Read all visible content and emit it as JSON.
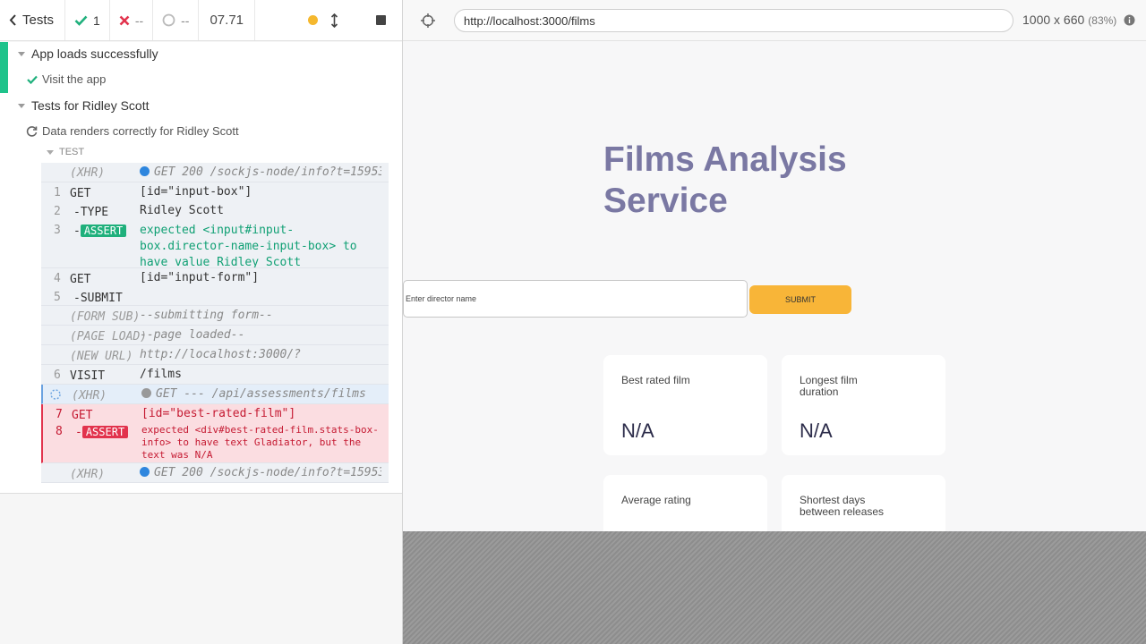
{
  "reporter": {
    "header": {
      "tests_label": "Tests",
      "passed": "1",
      "failed": "--",
      "pending": "--",
      "duration": "07.71"
    },
    "suites": [
      {
        "title": "App loads successfully",
        "tests": [
          {
            "title": "Visit the app",
            "state": "passed"
          }
        ]
      },
      {
        "title": "Tests for Ridley Scott",
        "tests": [
          {
            "title": "Data renders correctly for Ridley Scott",
            "state": "running"
          }
        ]
      }
    ],
    "test_section_label": "TEST",
    "commands": [
      {
        "num": "",
        "name": "(XHR)",
        "msg": "GET 200 /sockjs-node/info?t=159535…"
      },
      {
        "num": "1",
        "name": "GET",
        "msg": "[id=\"input-box\"]"
      },
      {
        "num": "2",
        "name": "-TYPE",
        "msg": "Ridley Scott"
      },
      {
        "num": "3",
        "name": "-",
        "badge": "ASSERT",
        "msg_parts": [
          "expected",
          "<input#input-box.director-name-input-box>",
          "to have value",
          "Ridley Scott"
        ]
      },
      {
        "num": "4",
        "name": "GET",
        "msg": "[id=\"input-form\"]"
      },
      {
        "num": "5",
        "name": "-SUBMIT",
        "msg": ""
      },
      {
        "num": "",
        "name": "(FORM SUB)",
        "msg": "--submitting form--"
      },
      {
        "num": "",
        "name": "(PAGE LOAD)",
        "msg": "--page loaded--"
      },
      {
        "num": "",
        "name": "(NEW URL)",
        "msg": "http://localhost:3000/?"
      },
      {
        "num": "6",
        "name": "VISIT",
        "msg": "/films"
      },
      {
        "num": "",
        "name": "(XHR)",
        "msg": "GET --- /api/assessments/films"
      },
      {
        "num": "7",
        "name": "GET",
        "msg": "[id=\"best-rated-film\"]"
      },
      {
        "num": "8",
        "name": "-",
        "badge": "ASSERT",
        "msg_parts": [
          "expected",
          "<div#best-rated-film.stats-box-info>",
          "to have text",
          "Gladiator",
          ", but the text was",
          "N/A"
        ]
      },
      {
        "num": "",
        "name": "(XHR)",
        "msg": "GET 200 /sockjs-node/info?t=159535…"
      }
    ]
  },
  "aut": {
    "url": "http://localhost:3000/films",
    "viewport": "1000 x 660",
    "scale": "(83%)",
    "app": {
      "title": "Films Analysis Service",
      "input_placeholder": "Enter director name",
      "submit_label": "SUBMIT",
      "cards": [
        {
          "label": "Best rated film",
          "value": "N/A"
        },
        {
          "label": "Longest film duration",
          "value": "N/A"
        },
        {
          "label": "Average rating",
          "value": ""
        },
        {
          "label": "Shortest days between releases",
          "value": ""
        }
      ]
    }
  },
  "colors": {
    "pass": "#1fc38b",
    "fail": "#e2334d",
    "title": "#7a78a3",
    "submit": "#f8b538"
  },
  "icons": [
    "chevron-left-icon",
    "check-icon",
    "x-icon",
    "spinner-icon",
    "updown-arrow-icon",
    "stop-icon",
    "crosshair-icon",
    "info-icon",
    "refresh-icon"
  ]
}
